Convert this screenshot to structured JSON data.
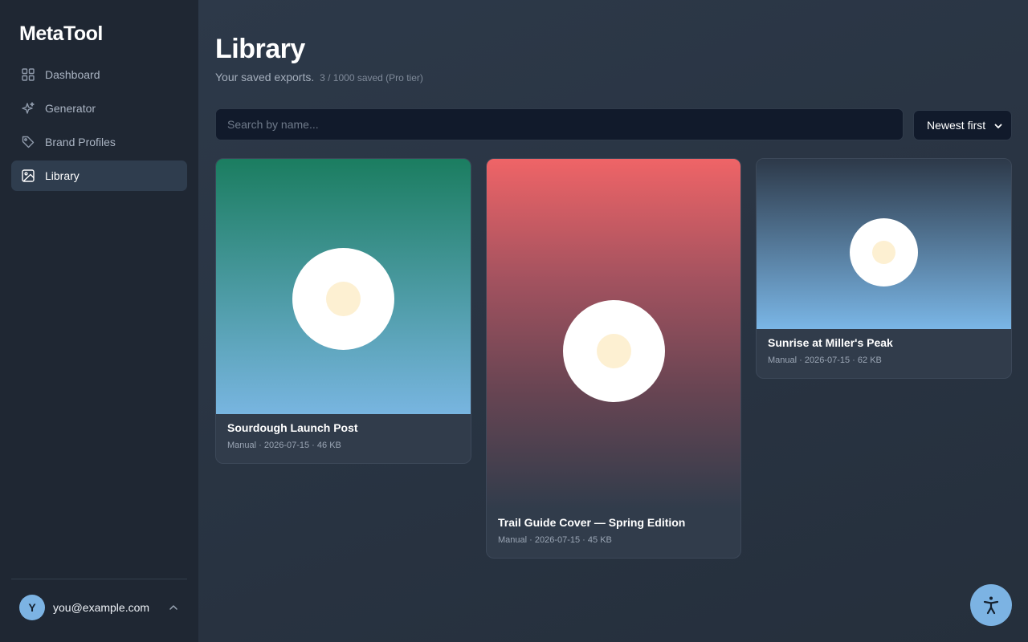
{
  "app": {
    "brand": "MetaTool"
  },
  "sidebar": {
    "items": [
      {
        "label": "Dashboard",
        "icon": "grid-icon",
        "active": false
      },
      {
        "label": "Generator",
        "icon": "sparkle-icon",
        "active": false
      },
      {
        "label": "Brand Profiles",
        "icon": "tag-icon",
        "active": false
      },
      {
        "label": "Library",
        "icon": "image-icon",
        "active": true
      }
    ],
    "user": {
      "initial": "Y",
      "email": "you@example.com"
    }
  },
  "main": {
    "title": "Library",
    "subtitle": "Your saved exports.",
    "count": "3 / 1000 saved (Pro tier)",
    "search": {
      "placeholder": "Search by name...",
      "value": ""
    },
    "sort": {
      "selected": "Newest first"
    },
    "cards": [
      {
        "title": "Sourdough Launch Post",
        "meta": "Manual · 2026-07-15 · 46 KB"
      },
      {
        "title": "Trail Guide Cover — Spring Edition",
        "meta": "Manual · 2026-07-15 · 45 KB"
      },
      {
        "title": "Sunrise at Miller's Peak",
        "meta": "Manual · 2026-07-15 · 62 KB"
      }
    ]
  },
  "colors": {
    "sidebar_bg": "#1f2733",
    "main_bg": "#283341",
    "accent": "#7cb3e3",
    "input_bg": "#111a2b"
  },
  "fab": {
    "icon": "accessibility-icon"
  }
}
